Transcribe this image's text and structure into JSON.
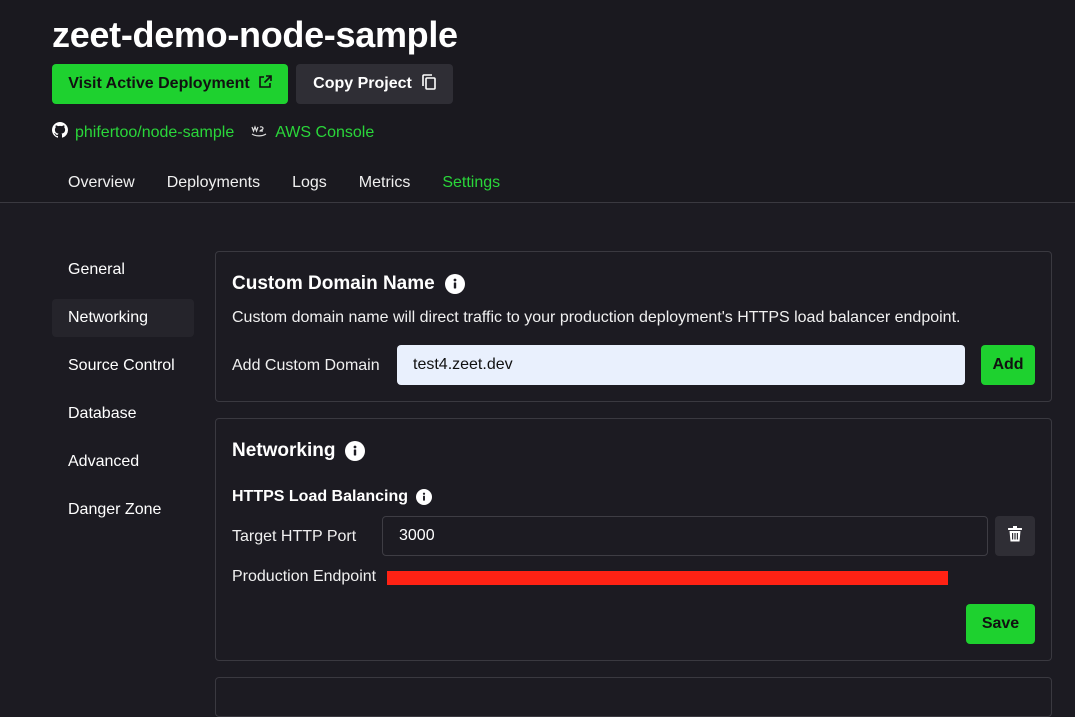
{
  "project": {
    "title": "zeet-demo-node-sample",
    "visit_label": "Visit Active Deployment",
    "copy_label": "Copy Project",
    "repo_label": "phifertoo/node-sample",
    "aws_label": "AWS Console"
  },
  "tabs": [
    {
      "label": "Overview"
    },
    {
      "label": "Deployments"
    },
    {
      "label": "Logs"
    },
    {
      "label": "Metrics"
    },
    {
      "label": "Settings",
      "active": true
    }
  ],
  "sidebar": {
    "items": [
      {
        "label": "General"
      },
      {
        "label": "Networking",
        "active": true
      },
      {
        "label": "Source Control"
      },
      {
        "label": "Database"
      },
      {
        "label": "Advanced"
      },
      {
        "label": "Danger Zone"
      }
    ]
  },
  "custom_domain": {
    "title": "Custom Domain Name",
    "description": "Custom domain name will direct traffic to your production deployment's HTTPS load balancer endpoint.",
    "field_label": "Add Custom Domain",
    "value": "test4.zeet.dev",
    "add_label": "Add"
  },
  "networking": {
    "title": "Networking",
    "subtitle": "HTTPS Load Balancing",
    "port_label": "Target HTTP Port",
    "port_value": "3000",
    "endpoint_label": "Production Endpoint",
    "save_label": "Save"
  },
  "colors": {
    "accent": "#1ed12f",
    "link": "#2ad63a",
    "background": "#1c1b22",
    "redaction": "#ff2214"
  }
}
